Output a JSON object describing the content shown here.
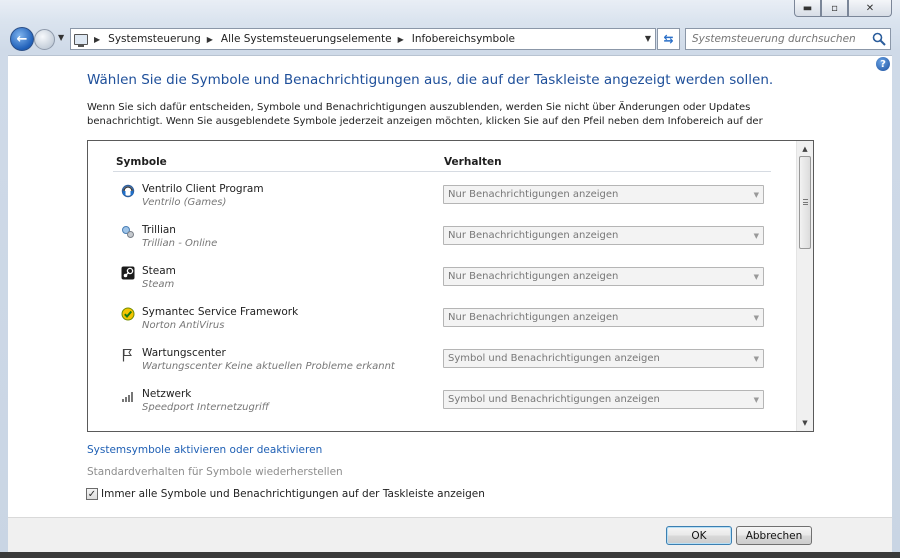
{
  "window": {
    "minimize": "▬",
    "maximize": "▫",
    "close": "✕"
  },
  "nav": {
    "back": "←",
    "breadcrumb": [
      "Systemsteuerung",
      "Alle Systemsteuerungselemente",
      "Infobereichsymbole"
    ],
    "search_placeholder": "Systemsteuerung durchsuchen"
  },
  "main": {
    "help": "?",
    "heading": "Wählen Sie die Symbole und Benachrichtigungen aus, die auf der Taskleiste angezeigt werden sollen.",
    "description": "Wenn Sie sich dafür entscheiden, Symbole und Benachrichtigungen auszublenden, werden Sie nicht über Änderungen oder Updates benachrichtigt. Wenn Sie ausgeblendete Symbole jederzeit anzeigen möchten, klicken Sie auf den Pfeil neben dem Infobereich auf der",
    "table": {
      "col_symbols": "Symbole",
      "col_behavior": "Verhalten",
      "rows": [
        {
          "name": "Ventrilo Client Program",
          "sub": "Ventrilo (Games)",
          "behavior": "Nur Benachrichtigungen anzeigen",
          "icon": "headset-icon"
        },
        {
          "name": "Trillian",
          "sub": "Trillian - Online",
          "behavior": "Nur Benachrichtigungen anzeigen",
          "icon": "trillian-icon"
        },
        {
          "name": "Steam",
          "sub": "Steam",
          "behavior": "Nur Benachrichtigungen anzeigen",
          "icon": "steam-icon"
        },
        {
          "name": "Symantec Service Framework",
          "sub": "Norton AntiVirus",
          "behavior": "Nur Benachrichtigungen anzeigen",
          "icon": "norton-icon"
        },
        {
          "name": "Wartungscenter",
          "sub": "Wartungscenter  Keine aktuellen Probleme erkannt",
          "behavior": "Symbol und Benachrichtigungen anzeigen",
          "icon": "flag-icon"
        },
        {
          "name": "Netzwerk",
          "sub": "Speedport Internetzugriff",
          "behavior": "Symbol und Benachrichtigungen anzeigen",
          "icon": "network-icon"
        }
      ]
    },
    "link_system_icons": "Systemsymbole aktivieren oder deaktivieren",
    "link_restore_defaults": "Standardverhalten für Symbole wiederherstellen",
    "checkbox_label": "Immer alle Symbole und Benachrichtigungen auf der Taskleiste anzeigen",
    "checkbox_checked": true
  },
  "footer": {
    "ok": "OK",
    "cancel": "Abbrechen"
  }
}
